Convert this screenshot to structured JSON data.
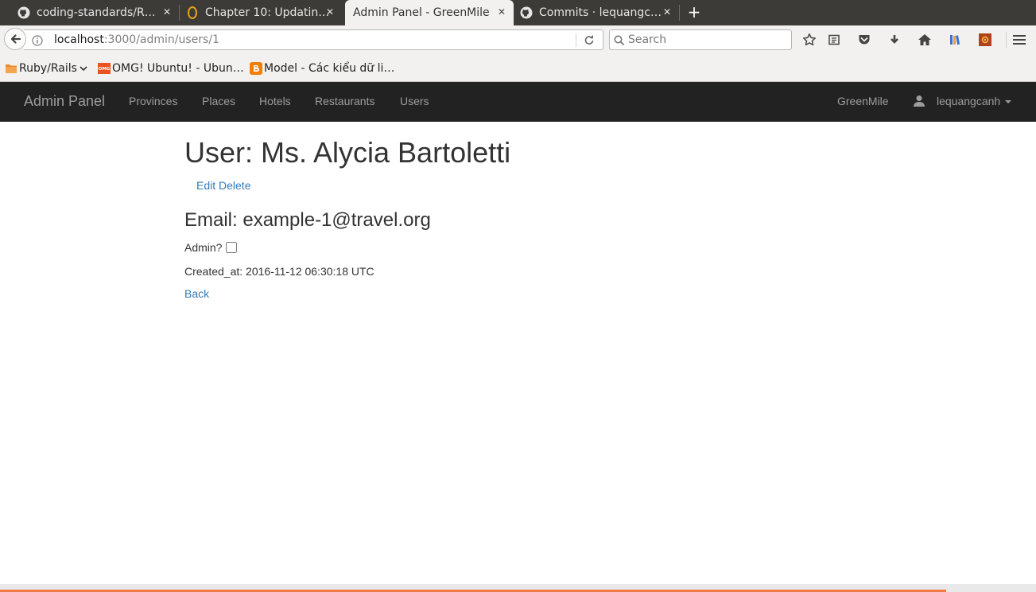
{
  "browser": {
    "tabs": [
      {
        "title": "coding-standards/R…",
        "icon": "github-icon"
      },
      {
        "title": "Chapter 10: Updatin…",
        "icon": "book-icon"
      },
      {
        "title": "Admin Panel - GreenMile",
        "icon": "none",
        "active": true
      },
      {
        "title": "Commits · lequangc…",
        "icon": "github-icon"
      }
    ],
    "url": {
      "host": "localhost",
      "path": ":3000/admin/users/1"
    },
    "search_placeholder": "Search",
    "bookmarks": [
      {
        "label": "Ruby/Rails",
        "icon": "folder-icon"
      },
      {
        "label": "OMG! Ubuntu! - Ubun…",
        "icon": "omg-icon"
      },
      {
        "label": "Model - Các kiểu dữ li…",
        "icon": "blogger-icon"
      }
    ]
  },
  "app": {
    "brand": "Admin Panel",
    "nav": [
      "Provinces",
      "Places",
      "Hotels",
      "Restaurants",
      "Users"
    ],
    "right": {
      "site": "GreenMile",
      "user": "lequangcanh"
    }
  },
  "page": {
    "title": "User: Ms. Alycia Bartoletti",
    "edit": "Edit",
    "delete": "Delete",
    "email": "Email: example-1@travel.org",
    "admin_label": "Admin?",
    "admin_checked": false,
    "created": "Created_at: 2016-11-12 06:30:18 UTC",
    "back": "Back"
  },
  "colors": {
    "navbar": "#222222",
    "link": "#337ab7",
    "nav_text": "#9d9d9d"
  }
}
